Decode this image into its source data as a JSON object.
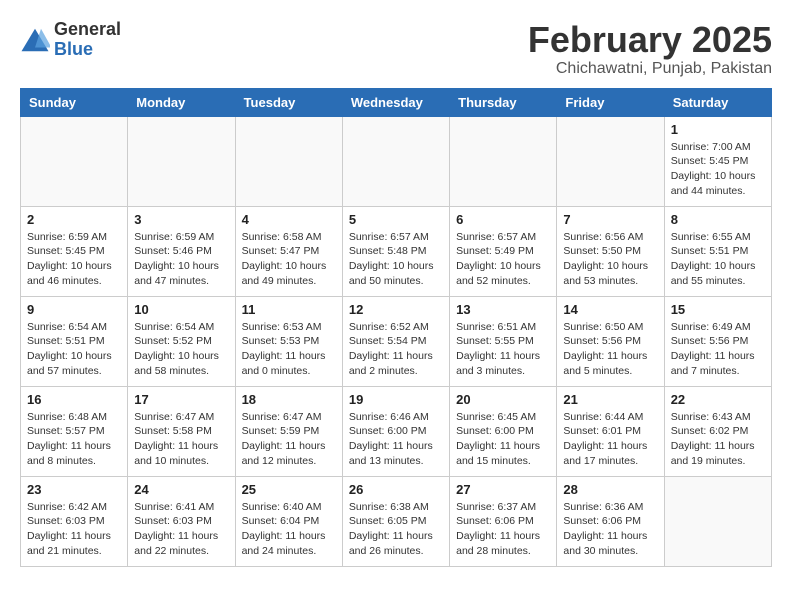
{
  "header": {
    "logo_general": "General",
    "logo_blue": "Blue",
    "month_title": "February 2025",
    "location": "Chichawatni, Punjab, Pakistan"
  },
  "weekdays": [
    "Sunday",
    "Monday",
    "Tuesday",
    "Wednesday",
    "Thursday",
    "Friday",
    "Saturday"
  ],
  "weeks": [
    [
      {
        "day": "",
        "info": ""
      },
      {
        "day": "",
        "info": ""
      },
      {
        "day": "",
        "info": ""
      },
      {
        "day": "",
        "info": ""
      },
      {
        "day": "",
        "info": ""
      },
      {
        "day": "",
        "info": ""
      },
      {
        "day": "1",
        "info": "Sunrise: 7:00 AM\nSunset: 5:45 PM\nDaylight: 10 hours\nand 44 minutes."
      }
    ],
    [
      {
        "day": "2",
        "info": "Sunrise: 6:59 AM\nSunset: 5:45 PM\nDaylight: 10 hours\nand 46 minutes."
      },
      {
        "day": "3",
        "info": "Sunrise: 6:59 AM\nSunset: 5:46 PM\nDaylight: 10 hours\nand 47 minutes."
      },
      {
        "day": "4",
        "info": "Sunrise: 6:58 AM\nSunset: 5:47 PM\nDaylight: 10 hours\nand 49 minutes."
      },
      {
        "day": "5",
        "info": "Sunrise: 6:57 AM\nSunset: 5:48 PM\nDaylight: 10 hours\nand 50 minutes."
      },
      {
        "day": "6",
        "info": "Sunrise: 6:57 AM\nSunset: 5:49 PM\nDaylight: 10 hours\nand 52 minutes."
      },
      {
        "day": "7",
        "info": "Sunrise: 6:56 AM\nSunset: 5:50 PM\nDaylight: 10 hours\nand 53 minutes."
      },
      {
        "day": "8",
        "info": "Sunrise: 6:55 AM\nSunset: 5:51 PM\nDaylight: 10 hours\nand 55 minutes."
      }
    ],
    [
      {
        "day": "9",
        "info": "Sunrise: 6:54 AM\nSunset: 5:51 PM\nDaylight: 10 hours\nand 57 minutes."
      },
      {
        "day": "10",
        "info": "Sunrise: 6:54 AM\nSunset: 5:52 PM\nDaylight: 10 hours\nand 58 minutes."
      },
      {
        "day": "11",
        "info": "Sunrise: 6:53 AM\nSunset: 5:53 PM\nDaylight: 11 hours\nand 0 minutes."
      },
      {
        "day": "12",
        "info": "Sunrise: 6:52 AM\nSunset: 5:54 PM\nDaylight: 11 hours\nand 2 minutes."
      },
      {
        "day": "13",
        "info": "Sunrise: 6:51 AM\nSunset: 5:55 PM\nDaylight: 11 hours\nand 3 minutes."
      },
      {
        "day": "14",
        "info": "Sunrise: 6:50 AM\nSunset: 5:56 PM\nDaylight: 11 hours\nand 5 minutes."
      },
      {
        "day": "15",
        "info": "Sunrise: 6:49 AM\nSunset: 5:56 PM\nDaylight: 11 hours\nand 7 minutes."
      }
    ],
    [
      {
        "day": "16",
        "info": "Sunrise: 6:48 AM\nSunset: 5:57 PM\nDaylight: 11 hours\nand 8 minutes."
      },
      {
        "day": "17",
        "info": "Sunrise: 6:47 AM\nSunset: 5:58 PM\nDaylight: 11 hours\nand 10 minutes."
      },
      {
        "day": "18",
        "info": "Sunrise: 6:47 AM\nSunset: 5:59 PM\nDaylight: 11 hours\nand 12 minutes."
      },
      {
        "day": "19",
        "info": "Sunrise: 6:46 AM\nSunset: 6:00 PM\nDaylight: 11 hours\nand 13 minutes."
      },
      {
        "day": "20",
        "info": "Sunrise: 6:45 AM\nSunset: 6:00 PM\nDaylight: 11 hours\nand 15 minutes."
      },
      {
        "day": "21",
        "info": "Sunrise: 6:44 AM\nSunset: 6:01 PM\nDaylight: 11 hours\nand 17 minutes."
      },
      {
        "day": "22",
        "info": "Sunrise: 6:43 AM\nSunset: 6:02 PM\nDaylight: 11 hours\nand 19 minutes."
      }
    ],
    [
      {
        "day": "23",
        "info": "Sunrise: 6:42 AM\nSunset: 6:03 PM\nDaylight: 11 hours\nand 21 minutes."
      },
      {
        "day": "24",
        "info": "Sunrise: 6:41 AM\nSunset: 6:03 PM\nDaylight: 11 hours\nand 22 minutes."
      },
      {
        "day": "25",
        "info": "Sunrise: 6:40 AM\nSunset: 6:04 PM\nDaylight: 11 hours\nand 24 minutes."
      },
      {
        "day": "26",
        "info": "Sunrise: 6:38 AM\nSunset: 6:05 PM\nDaylight: 11 hours\nand 26 minutes."
      },
      {
        "day": "27",
        "info": "Sunrise: 6:37 AM\nSunset: 6:06 PM\nDaylight: 11 hours\nand 28 minutes."
      },
      {
        "day": "28",
        "info": "Sunrise: 6:36 AM\nSunset: 6:06 PM\nDaylight: 11 hours\nand 30 minutes."
      },
      {
        "day": "",
        "info": ""
      }
    ]
  ]
}
